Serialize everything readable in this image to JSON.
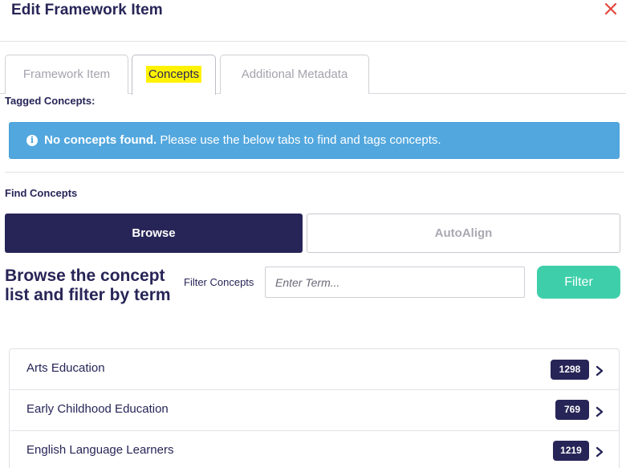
{
  "dialog": {
    "title": "Edit Framework Item",
    "close_icon": "close-icon",
    "close_color": "#e2473b"
  },
  "tabs": [
    {
      "label": "Framework Item",
      "active": false
    },
    {
      "label": "Concepts",
      "active": true
    },
    {
      "label": "Additional Metadata",
      "active": false
    }
  ],
  "tagged": {
    "label": "Tagged Concepts:",
    "alert_icon": "info-icon",
    "alert_bold": "No concepts found.",
    "alert_text": " Please use the below tabs to find and tags concepts.",
    "alert_color": "#52a7de"
  },
  "find": {
    "label": "Find Concepts",
    "browse_label": "Browse",
    "autoalign_label": "AutoAlign",
    "heading": "Browse the concept list and filter by term",
    "filter_label": "Filter Concepts",
    "filter_placeholder": "Enter Term...",
    "filter_value": "",
    "filter_button": "Filter",
    "filter_color": "#3ecfaa",
    "primary_color": "#272557"
  },
  "concepts": [
    {
      "name": "Arts Education",
      "count": "1298"
    },
    {
      "name": "Early Childhood Education",
      "count": "769"
    },
    {
      "name": "English Language Learners",
      "count": "1219"
    }
  ]
}
